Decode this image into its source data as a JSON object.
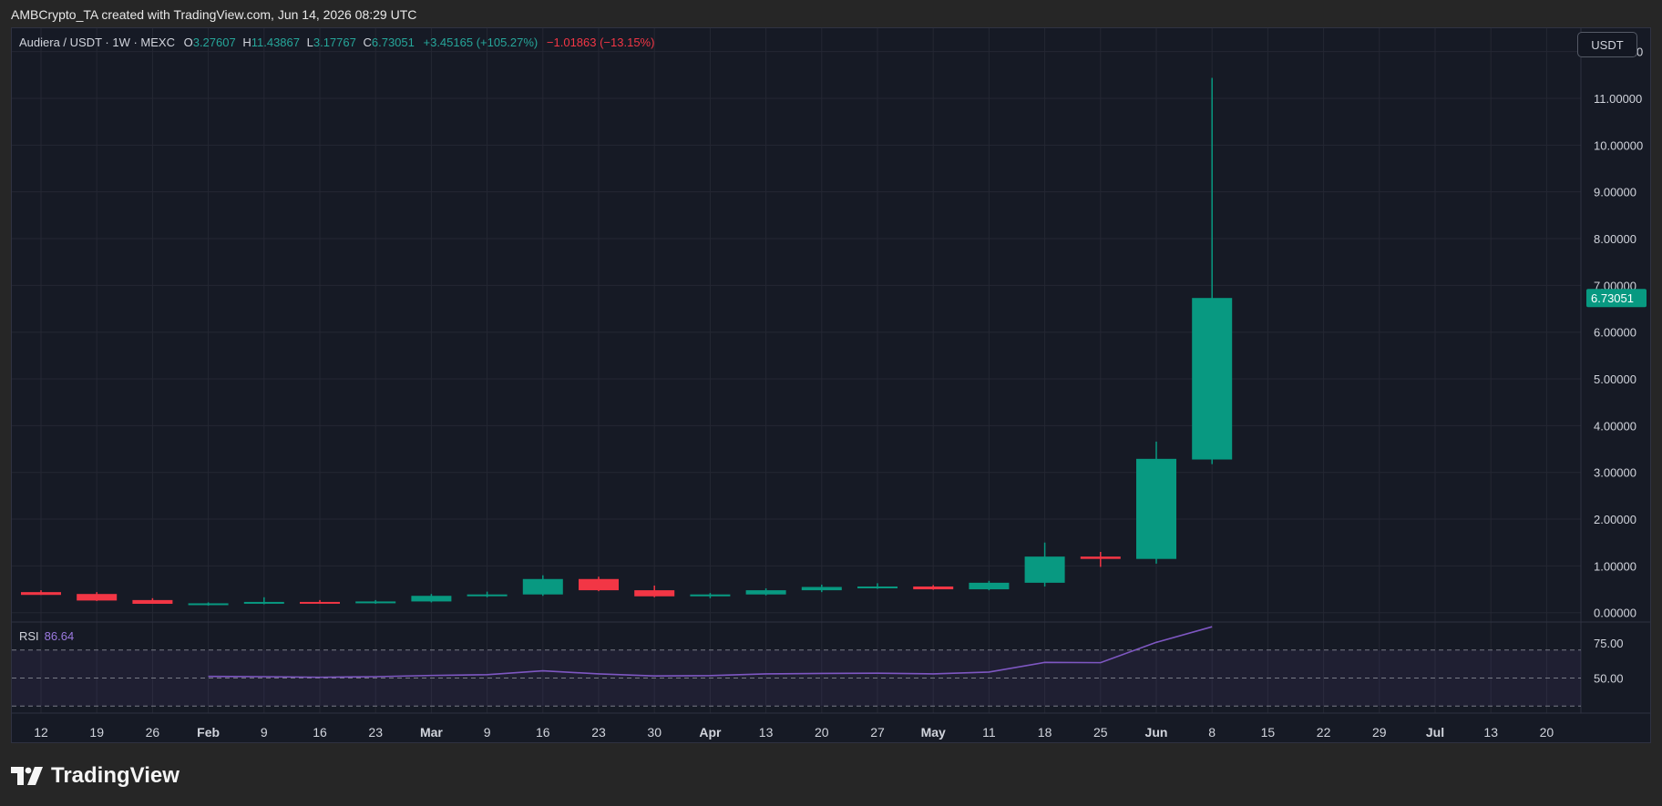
{
  "caption": "AMBCrypto_TA created with TradingView.com, Jun 14, 2026 08:29 UTC",
  "brand": "TradingView",
  "currency_button": "USDT",
  "legend": {
    "symbol": "Audiera / USDT · 1W · MEXC",
    "open_label": "O",
    "open": "3.27607",
    "high_label": "H",
    "high": "11.43867",
    "low_label": "L",
    "low": "3.17767",
    "close_label": "C",
    "close": "6.73051",
    "change": "+3.45165 (+105.27%)",
    "change2": "−1.01863 (−13.15%)"
  },
  "rsi": {
    "label": "RSI",
    "value": "86.64"
  },
  "colors": {
    "up": "#089981",
    "down": "#f23645",
    "rsi": "#7e57c2",
    "background": "#161a25",
    "grid": "#242733"
  },
  "chart_data": {
    "type": "candlestick",
    "price_axis": {
      "ticks": [
        0,
        1,
        2,
        3,
        4,
        5,
        6,
        7,
        8,
        9,
        10,
        11,
        12
      ],
      "tick_labels": [
        "0.00000",
        "1.00000",
        "2.00000",
        "3.00000",
        "4.00000",
        "5.00000",
        "6.00000",
        "7.00000",
        "8.00000",
        "9.00000",
        "10.00000",
        "11.00000",
        "12.00000"
      ],
      "range": [
        -0.2,
        12.5
      ],
      "last_price_label": "6.73051"
    },
    "x_axis": {
      "labels": [
        "12",
        "19",
        "26",
        "Feb",
        "9",
        "16",
        "23",
        "Mar",
        "9",
        "16",
        "23",
        "30",
        "Apr",
        "13",
        "20",
        "27",
        "May",
        "11",
        "18",
        "25",
        "Jun",
        "8",
        "15",
        "22",
        "29",
        "Jul",
        "13",
        "20"
      ],
      "bold": [
        "Feb",
        "Mar",
        "Apr",
        "May",
        "Jun",
        "Jul"
      ]
    },
    "candles": [
      {
        "o": 0.44,
        "h": 0.48,
        "l": 0.38,
        "c": 0.38
      },
      {
        "o": 0.4,
        "h": 0.44,
        "l": 0.25,
        "c": 0.26
      },
      {
        "o": 0.27,
        "h": 0.31,
        "l": 0.19,
        "c": 0.19
      },
      {
        "o": 0.19,
        "h": 0.22,
        "l": 0.15,
        "c": 0.2
      },
      {
        "o": 0.2,
        "h": 0.33,
        "l": 0.18,
        "c": 0.23
      },
      {
        "o": 0.23,
        "h": 0.27,
        "l": 0.2,
        "c": 0.21
      },
      {
        "o": 0.21,
        "h": 0.27,
        "l": 0.19,
        "c": 0.24
      },
      {
        "o": 0.24,
        "h": 0.4,
        "l": 0.22,
        "c": 0.36
      },
      {
        "o": 0.36,
        "h": 0.45,
        "l": 0.33,
        "c": 0.39
      },
      {
        "o": 0.39,
        "h": 0.8,
        "l": 0.36,
        "c": 0.72
      },
      {
        "o": 0.72,
        "h": 0.77,
        "l": 0.46,
        "c": 0.48
      },
      {
        "o": 0.48,
        "h": 0.58,
        "l": 0.33,
        "c": 0.35
      },
      {
        "o": 0.35,
        "h": 0.42,
        "l": 0.31,
        "c": 0.39
      },
      {
        "o": 0.39,
        "h": 0.52,
        "l": 0.37,
        "c": 0.48
      },
      {
        "o": 0.48,
        "h": 0.6,
        "l": 0.44,
        "c": 0.55
      },
      {
        "o": 0.55,
        "h": 0.63,
        "l": 0.51,
        "c": 0.56
      },
      {
        "o": 0.56,
        "h": 0.59,
        "l": 0.49,
        "c": 0.5
      },
      {
        "o": 0.5,
        "h": 0.68,
        "l": 0.48,
        "c": 0.64
      },
      {
        "o": 0.64,
        "h": 1.5,
        "l": 0.56,
        "c": 1.2
      },
      {
        "o": 1.2,
        "h": 1.3,
        "l": 0.98,
        "c": 1.15
      },
      {
        "o": 1.15,
        "h": 3.66,
        "l": 1.05,
        "c": 3.29
      },
      {
        "o": 3.27607,
        "h": 11.43867,
        "l": 3.17767,
        "c": 6.73051
      }
    ],
    "rsi_axis": {
      "ticks": [
        50,
        75
      ],
      "tick_labels": [
        "50.00",
        "75.00"
      ],
      "bands": [
        30,
        70
      ],
      "range": [
        25,
        90
      ]
    },
    "rsi_values": [
      null,
      null,
      null,
      51.2,
      51.0,
      50.6,
      51.0,
      51.9,
      52.4,
      55.2,
      53.0,
      51.5,
      51.8,
      53.0,
      53.3,
      53.5,
      53.0,
      54.3,
      61.2,
      61.0,
      75.5,
      86.64
    ]
  }
}
